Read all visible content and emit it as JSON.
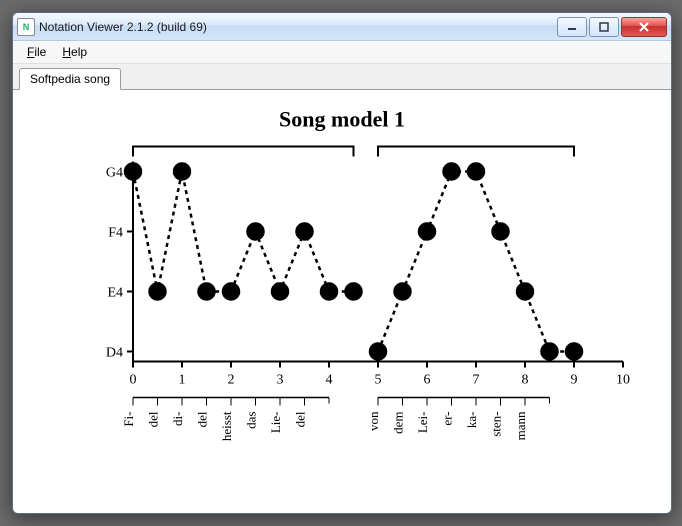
{
  "window": {
    "title": "Notation Viewer 2.1.2 (build 69)",
    "app_icon_text": "N"
  },
  "menu": {
    "file": "File",
    "help": "Help"
  },
  "tabs": {
    "active": "Softpedia song"
  },
  "chart_data": {
    "type": "scatter",
    "title": "Song model 1",
    "xlabel": "",
    "ylabel": "",
    "x_ticks": [
      0,
      1,
      2,
      3,
      4,
      5,
      6,
      7,
      8,
      9,
      10
    ],
    "y_ticks": [
      "D4",
      "E4",
      "F4",
      "G4"
    ],
    "pitch_map": {
      "D4": 0,
      "E4": 1,
      "F4": 2,
      "G4": 3
    },
    "segments": [
      {
        "x": [
          0,
          0.5,
          1,
          1.5,
          2,
          2.5,
          3,
          3.5,
          4,
          4.5
        ],
        "pitches": [
          "G4",
          "E4",
          "G4",
          "E4",
          "E4",
          "F4",
          "E4",
          "F4",
          "E4",
          "E4"
        ],
        "syllables": [
          "Fi-",
          "del",
          "di-",
          "del",
          "heisst",
          "das",
          "Lie-",
          "del",
          "",
          ""
        ]
      },
      {
        "x": [
          5,
          5.5,
          6,
          6.5,
          7,
          7.5,
          8,
          8.5,
          9
        ],
        "pitches": [
          "D4",
          "E4",
          "F4",
          "G4",
          "G4",
          "F4",
          "E4",
          "D4",
          "D4"
        ],
        "syllables": [
          "von",
          "dem",
          "Lei-",
          "er-",
          "ka-",
          "sten-",
          "mann",
          "",
          ""
        ]
      }
    ],
    "syllable_x": [
      0,
      0.5,
      1,
      1.5,
      2,
      2.5,
      3,
      3.5,
      5,
      5.5,
      6,
      6.5,
      7,
      7.5,
      8
    ],
    "syllable_labels": [
      "Fi-",
      "del",
      "di-",
      "del",
      "heisst",
      "das",
      "Lie-",
      "del",
      "von",
      "dem",
      "Lei-",
      "er-",
      "ka-",
      "sten-",
      "mann"
    ]
  }
}
